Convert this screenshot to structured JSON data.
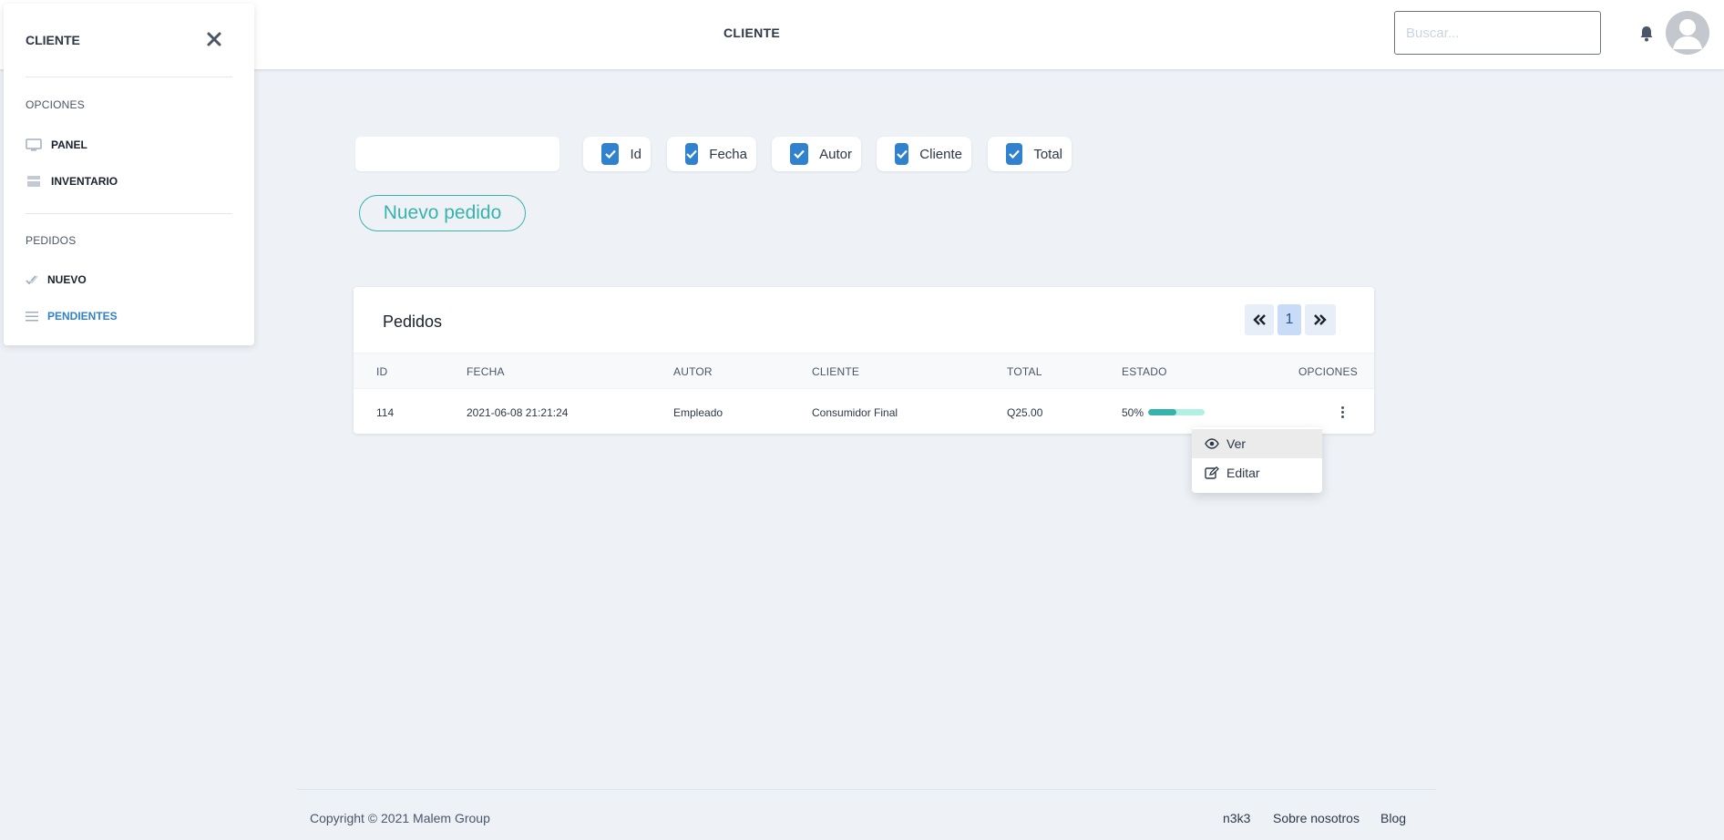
{
  "header": {
    "title": "CLIENTE",
    "search_placeholder": "Buscar..."
  },
  "sidebar": {
    "title": "CLIENTE",
    "sections": [
      {
        "label": "OPCIONES",
        "items": [
          {
            "label": "PANEL",
            "icon": "monitor-icon"
          },
          {
            "label": "INVENTARIO",
            "icon": "store-icon"
          }
        ]
      },
      {
        "label": "PEDIDOS",
        "items": [
          {
            "label": "NUEVO",
            "icon": "double-check-icon"
          },
          {
            "label": "PENDIENTES",
            "icon": "list-icon",
            "active": true
          }
        ]
      }
    ]
  },
  "filters": {
    "search_value": "",
    "columns": [
      {
        "label": "Id",
        "checked": true
      },
      {
        "label": "Fecha",
        "checked": true
      },
      {
        "label": "Autor",
        "checked": true
      },
      {
        "label": "Cliente",
        "checked": true
      },
      {
        "label": "Total",
        "checked": true
      }
    ]
  },
  "actions": {
    "new_order_label": "Nuevo pedido"
  },
  "orders": {
    "title": "Pedidos",
    "pagination": {
      "current_page": "1"
    },
    "columns": [
      "ID",
      "FECHA",
      "AUTOR",
      "CLIENTE",
      "TOTAL",
      "ESTADO",
      "OPCIONES"
    ],
    "rows": [
      {
        "id": "114",
        "fecha": "2021-06-08 21:21:24",
        "autor": "Empleado",
        "cliente": "Consumidor Final",
        "total": "Q25.00",
        "estado_label": "50%",
        "estado_percent": 50
      }
    ]
  },
  "row_menu": {
    "items": [
      {
        "label": "Ver",
        "icon": "eye-icon"
      },
      {
        "label": "Editar",
        "icon": "edit-icon"
      }
    ]
  },
  "footer": {
    "copyright": "Copyright © 2021 Malem Group",
    "links": [
      "n3k3",
      "Sobre nosotros",
      "Blog"
    ]
  },
  "colors": {
    "accent": "#3182ce",
    "teal": "#38b2ac",
    "background": "#eef2f7"
  }
}
